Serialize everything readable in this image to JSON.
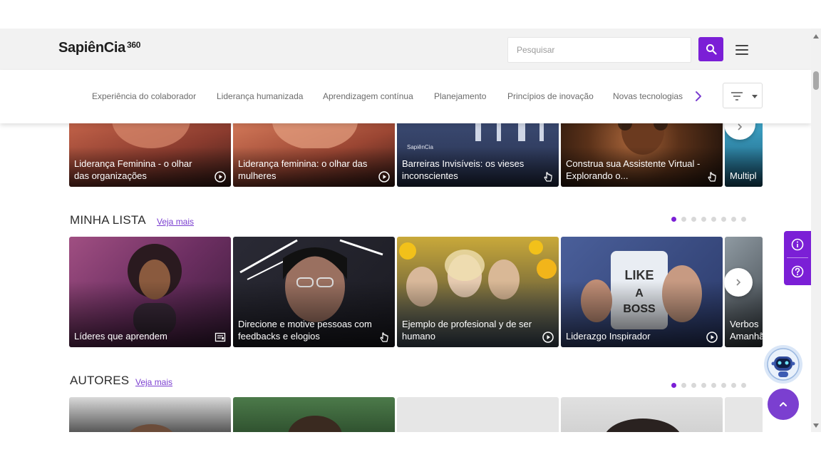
{
  "header": {
    "logo_text": "SapiênCia",
    "logo_suffix": "360",
    "search_placeholder": "Pesquisar",
    "search_icon": "search-icon",
    "menu_icon": "hamburger-menu-icon"
  },
  "categories": {
    "items": [
      "Experiência do colaborador",
      "Liderança humanizada",
      "Aprendizagem contínua",
      "Planejamento",
      "Princípios de inovação",
      "Novas tecnologias"
    ],
    "next_icon": "chevron-right-icon",
    "filter_icon": "filter-icon"
  },
  "top_row": {
    "cards": [
      {
        "title": "Liderança Feminina - o olhar das organizações",
        "icon": "play-circle-icon"
      },
      {
        "title": "Liderança feminina: o olhar das mulheres",
        "icon": "play-circle-icon"
      },
      {
        "title": "Barreiras Invisíveis: os vieses inconscientes",
        "icon": "hand-pointer-icon",
        "brand": "SapiênCia"
      },
      {
        "title": "Construa sua Assistente Virtual - Explorando o...",
        "icon": "hand-pointer-icon"
      },
      {
        "title": "Multipl",
        "icon": ""
      }
    ]
  },
  "minha_lista": {
    "title": "MINHA LISTA",
    "see_more": "Veja mais",
    "dots_total": 8,
    "dots_active": 1,
    "cards": [
      {
        "title": "Líderes que aprendem",
        "icon": "article-icon"
      },
      {
        "title": "Direcione e motive pessoas com feedbacks e elogios",
        "icon": "hand-pointer-icon"
      },
      {
        "title": "Ejemplo de profesional y de ser humano",
        "icon": "play-circle-icon"
      },
      {
        "title": "Liderazgo Inspirador",
        "icon": "play-circle-icon",
        "mug_text": "LIKE A BOSS"
      },
      {
        "title": "Verbos Amanhã",
        "icon": ""
      }
    ]
  },
  "autores": {
    "title": "AUTORES",
    "see_more": "Veja mais",
    "dots_total": 8,
    "dots_active": 1
  },
  "side_tabs": {
    "info_icon": "info-icon",
    "help_icon": "help-icon"
  },
  "floating": {
    "bot_icon": "robot-assistant-icon",
    "scroll_top_icon": "chevron-up-icon"
  },
  "colors": {
    "brand_purple": "#7b1fd6",
    "link_purple": "#7b3fd0",
    "header_bg": "#f2f2f2"
  }
}
